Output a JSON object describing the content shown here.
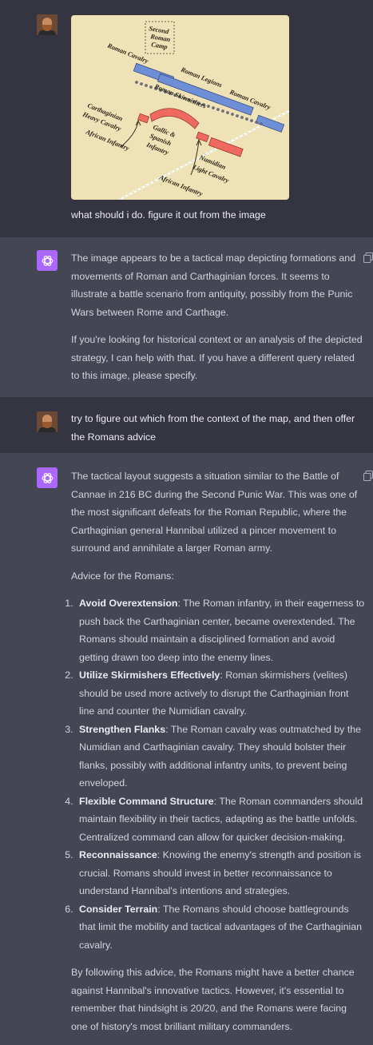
{
  "conversation": {
    "turn1": {
      "user_text": "what should i do. figure it out from the image",
      "map_labels": {
        "second_roman_camp": [
          "Second",
          "Roman",
          "Camp"
        ],
        "roman_cavalry_left": "Roman Cavalry",
        "roman_legions": "Roman Legions",
        "roman_cavalry_right": "Roman Cavalry",
        "roman_skirmishers": "Roman Skirmishers",
        "carthaginian_heavy_cavalry": [
          "Carthaginian",
          "Heavy Cavalry"
        ],
        "gallic_spanish_infantry": [
          "Gallic &",
          "Spanish",
          "Infantry"
        ],
        "african_infantry_left": "African Infantry",
        "numidian_light_cavalry": [
          "Numidian",
          "Light Cavalry"
        ],
        "african_infantry_right": "African Infantry"
      },
      "colors": {
        "map_bg": "#efe2b6",
        "roman_blue": "#6e8fd6",
        "carthage_red": "#ef6a5e"
      }
    },
    "turn2": {
      "paragraphs": [
        "The image appears to be a tactical map depicting formations and movements of Roman and Carthaginian forces. It seems to illustrate a battle scenario from antiquity, possibly from the Punic Wars between Rome and Carthage.",
        "If you're looking for historical context or an analysis of the depicted strategy, I can help with that. If you have a different query related to this image, please specify."
      ]
    },
    "turn3": {
      "user_text": "try to figure out which from the context of the map, and then offer the Romans advice"
    },
    "turn4": {
      "intro": "The tactical layout suggests a situation similar to the Battle of Cannae in 216 BC during the Second Punic War. This was one of the most significant defeats for the Roman Republic, where the Carthaginian general Hannibal utilized a pincer movement to surround and annihilate a larger Roman army.",
      "advice_heading": "Advice for the Romans:",
      "advice": [
        {
          "title": "Avoid Overextension",
          "text": ": The Roman infantry, in their eagerness to push back the Carthaginian center, became overextended. The Romans should maintain a disciplined formation and avoid getting drawn too deep into the enemy lines."
        },
        {
          "title": "Utilize Skirmishers Effectively",
          "text": ": Roman skirmishers (velites) should be used more actively to disrupt the Carthaginian front line and counter the Numidian cavalry."
        },
        {
          "title": "Strengthen Flanks",
          "text": ": The Roman cavalry was outmatched by the Numidian and Carthaginian cavalry. They should bolster their flanks, possibly with additional infantry units, to prevent being enveloped."
        },
        {
          "title": "Flexible Command Structure",
          "text": ": The Roman commanders should maintain flexibility in their tactics, adapting as the battle unfolds. Centralized command can allow for quicker decision-making."
        },
        {
          "title": "Reconnaissance",
          "text": ": Knowing the enemy's strength and position is crucial. Romans should invest in better reconnaissance to understand Hannibal's intentions and strategies."
        },
        {
          "title": "Consider Terrain",
          "text": ": The Romans should choose battlegrounds that limit the mobility and tactical advantages of the Carthaginian cavalry."
        }
      ],
      "closing": "By following this advice, the Romans might have a better chance against Hannibal's innovative tactics. However, it's essential to remember that hindsight is 20/20, and the Romans were facing one of history's most brilliant military commanders."
    }
  }
}
